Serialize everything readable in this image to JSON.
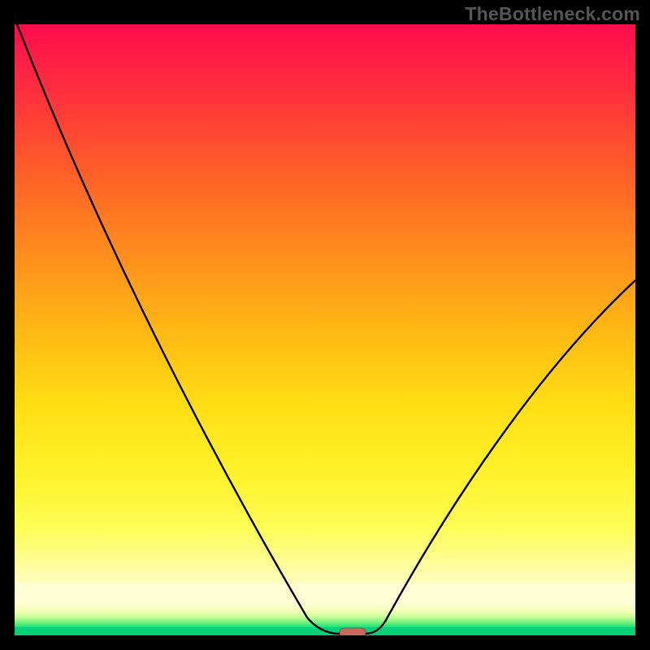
{
  "watermark": "TheBottleneck.com",
  "chart_data": {
    "type": "line",
    "title": "",
    "xlabel": "",
    "ylabel": "",
    "x": [
      0,
      5,
      10,
      15,
      20,
      25,
      30,
      35,
      40,
      45,
      50,
      52,
      54,
      56,
      58,
      60,
      65,
      70,
      75,
      80,
      85,
      90,
      95,
      100
    ],
    "series": [
      {
        "name": "bottleneck-curve",
        "values": [
          100,
          90,
          78,
          66,
          54,
          43,
          33,
          24,
          16,
          9,
          3,
          1,
          0,
          0,
          1,
          4,
          11,
          20,
          29,
          38,
          46,
          53,
          58,
          62
        ]
      }
    ],
    "xlim": [
      0,
      100
    ],
    "ylim": [
      0,
      100
    ],
    "optimum_x": 54,
    "marker": {
      "x": 54,
      "y": 0,
      "color": "#c96a5e"
    },
    "background_gradient": {
      "top": "#ff0d4d",
      "mid": "#ffde15",
      "bottom": "#04d176"
    }
  }
}
